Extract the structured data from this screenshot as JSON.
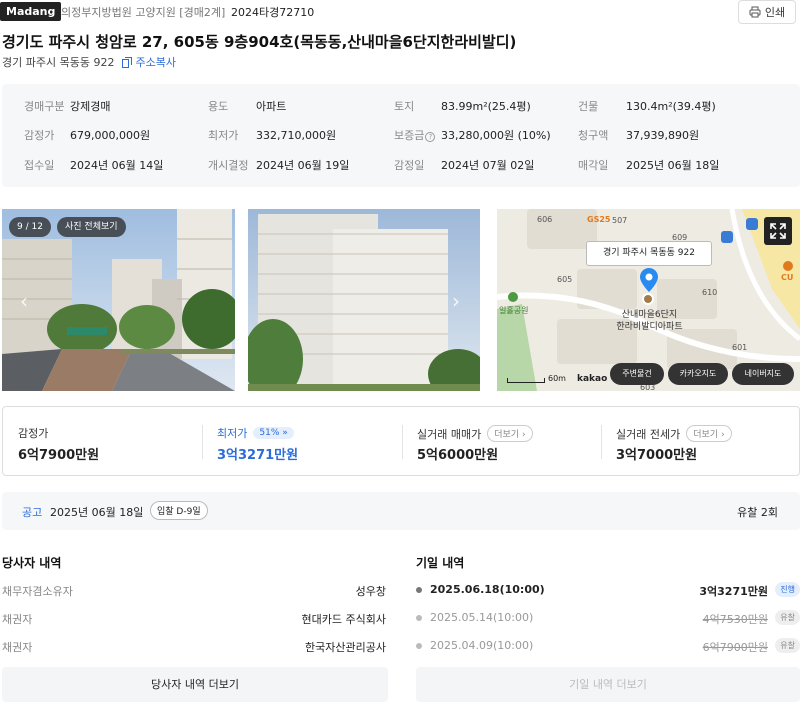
{
  "header": {
    "logo": "Madang",
    "court": "의정부지방법원 고양지원 [경매2계]",
    "case_no": "2024타경72710",
    "print_label": "인쇄"
  },
  "title": "경기도 파주시 청암로 27, 605동 9층904호(목동동,산내마을6단지한라비발디)",
  "sub_address": "경기 파주시 목동동 922",
  "copy_label": "주소복사",
  "info": [
    {
      "k": "경매구분",
      "v": "강제경매"
    },
    {
      "k": "용도",
      "v": "아파트"
    },
    {
      "k": "토지",
      "v": "83.99m²(25.4평)"
    },
    {
      "k": "건물",
      "v": "130.4m²(39.4평)"
    },
    {
      "k": "감정가",
      "v": "679,000,000원"
    },
    {
      "k": "최저가",
      "v": "332,710,000원"
    },
    {
      "k": "보증금",
      "v": "33,280,000원 (10%)"
    },
    {
      "k": "청구액",
      "v": "37,939,890원"
    },
    {
      "k": "접수일",
      "v": "2024년 06월 14일"
    },
    {
      "k": "개시결정",
      "v": "2024년 06월 19일"
    },
    {
      "k": "감정일",
      "v": "2024년 07월 02일"
    },
    {
      "k": "매각일",
      "v": "2025년 06월 18일"
    }
  ],
  "photos": {
    "counter": "9 / 12",
    "view_all": "사진 전체보기"
  },
  "map": {
    "callout": "경기 파주시 목동동 922",
    "place_line1": "산내마을6단지",
    "place_line2": "한라비발디아파트",
    "labels": [
      "606",
      "GS25",
      "507",
      "609",
      "605",
      "610",
      "601",
      "603",
      "CU",
      "일홀공원"
    ],
    "scale": "60m",
    "brand": "kakao",
    "btn_nearby": "주변물건",
    "btn_kakao": "카카오지도",
    "btn_naver": "네이버지도"
  },
  "prices": {
    "appraisal_label": "감정가",
    "appraisal_value": "6억7900만원",
    "min_label": "최저가",
    "min_pct": "51%",
    "min_value": "3억3271만원",
    "sale_label": "실거래 매매가",
    "sale_value": "5억6000만원",
    "jeonse_label": "실거래 전세가",
    "jeonse_value": "3억7000만원",
    "more": "더보기"
  },
  "notice": {
    "label": "공고",
    "date": "2025년 06월 18일",
    "dday": "입찰 D-9일",
    "fail_count": "유찰 2회"
  },
  "parties": {
    "title": "당사자 내역",
    "rows": [
      {
        "role": "채무자겸소유자",
        "name": "성우창"
      },
      {
        "role": "채권자",
        "name": "현대카드 주식회사"
      },
      {
        "role": "채권자",
        "name": "한국자산관리공사"
      }
    ],
    "more": "당사자 내역 더보기"
  },
  "history": {
    "title": "기일 내역",
    "rows": [
      {
        "date": "2025.06.18(10:00)",
        "price": "3억3271만원",
        "status": "진행"
      },
      {
        "date": "2025.05.14(10:00)",
        "price": "4억7530만원",
        "status": "유찰"
      },
      {
        "date": "2025.04.09(10:00)",
        "price": "6억7900만원",
        "status": "유찰"
      }
    ],
    "more": "기일 내역 더보기"
  },
  "colors": {
    "accent": "#2b6cd9",
    "panel": "#f6f7f9"
  }
}
